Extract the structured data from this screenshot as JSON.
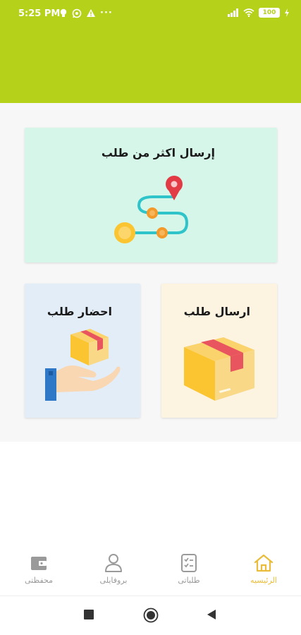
{
  "status_bar": {
    "time": "5:25 PM",
    "battery": "100",
    "more": "···",
    "icons_left": [
      "bulb-icon",
      "whatsapp-icon",
      "alert-icon"
    ],
    "icons_right": [
      "signal-icon",
      "wifi-icon",
      "battery-icon",
      "charging-icon"
    ]
  },
  "colors": {
    "header": "#b5d11a",
    "card_multi": "#d6f6ea",
    "card_send": "#fcf3e1",
    "card_fetch": "#e2edf8",
    "active_nav": "#e9bd3b",
    "inactive_nav": "#9a9a9a"
  },
  "cards": {
    "multi_title": "إرسال اكثر من طلب",
    "multi_icon": "route-icon",
    "send_title": "ارسال طلب",
    "send_icon": "box-icon",
    "fetch_title": "احضار طلب",
    "fetch_icon": "hand-box-icon"
  },
  "bottom_nav": {
    "items": [
      {
        "label": "الرئيسيه",
        "icon": "home-icon",
        "active": true
      },
      {
        "label": "طلباتى",
        "icon": "checklist-icon",
        "active": false
      },
      {
        "label": "بروفايلى",
        "icon": "user-icon",
        "active": false
      },
      {
        "label": "محفظتى",
        "icon": "wallet-icon",
        "active": false
      }
    ]
  },
  "system_nav": {
    "icons": [
      "recents-icon",
      "home-circle-icon",
      "back-icon"
    ]
  }
}
